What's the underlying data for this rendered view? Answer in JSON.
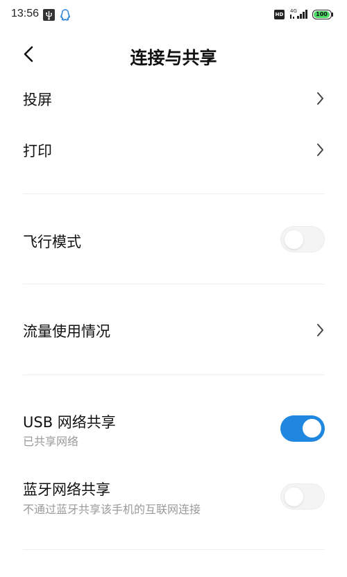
{
  "status_bar": {
    "time": "13:56",
    "hd_label": "HD",
    "network_type": "4G",
    "battery_level": "100",
    "battery_color": "#4cd964",
    "icons": [
      "usb-icon",
      "qq-icon",
      "hd-icon",
      "signal-icon",
      "battery-icon"
    ]
  },
  "header": {
    "title": "连接与共享",
    "back_icon": "back-arrow-icon"
  },
  "items": {
    "cast": {
      "label": "投屏",
      "icon": "chevron-right-icon"
    },
    "print": {
      "label": "打印",
      "icon": "chevron-right-icon"
    },
    "airplane": {
      "label": "飞行模式",
      "toggle_on": false
    },
    "data_usage": {
      "label": "流量使用情况",
      "icon": "chevron-right-icon"
    },
    "usb_tethering": {
      "label": "USB 网络共享",
      "subtitle": "已共享网络",
      "toggle_on": true
    },
    "bt_tethering": {
      "label": "蓝牙网络共享",
      "subtitle": "不通过蓝牙共享该手机的互联网连接",
      "toggle_on": false
    }
  },
  "colors": {
    "accent": "#1f87e0",
    "subtitle": "#9a9a9a",
    "divider": "#ececec"
  }
}
